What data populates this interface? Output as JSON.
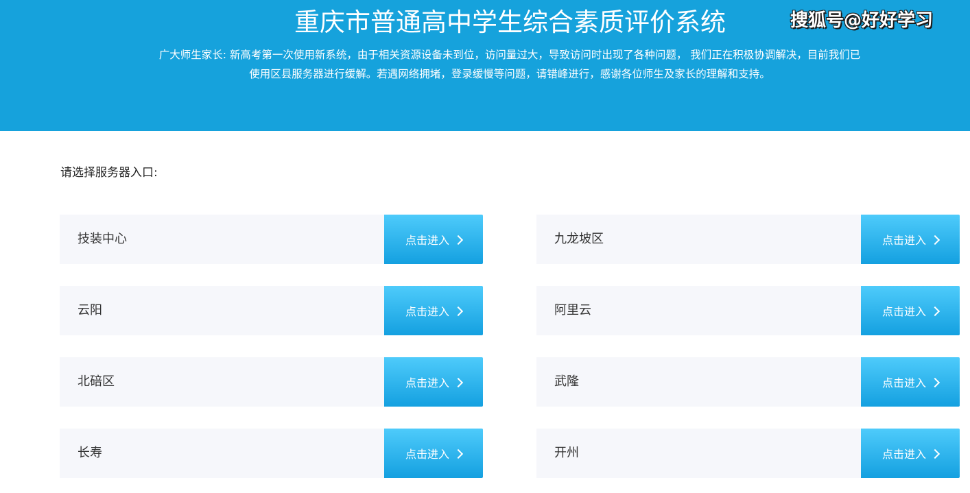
{
  "header": {
    "title": "重庆市普通高中学生综合素质评价系统",
    "watermark": "搜狐号@好好学习",
    "notice_line1": "广大师生家长: 新高考第一次使用新系统，由于相关资源设备未到位，访问量过大，导致访问时出现了各种问题， 我们正在积极协调解决，目前我们已",
    "notice_line2": "使用区县服务器进行缓解。若遇网络拥堵，登录缓慢等问题，请错峰进行，感谢各位师生及家长的理解和支持。"
  },
  "main": {
    "prompt": "请选择服务器入口:",
    "button_label": "点击进入",
    "entries": [
      {
        "name": "技装中心"
      },
      {
        "name": "九龙坡区"
      },
      {
        "name": "云阳"
      },
      {
        "name": "阿里云"
      },
      {
        "name": "北碚区"
      },
      {
        "name": "武隆"
      },
      {
        "name": "长寿"
      },
      {
        "name": "开州"
      }
    ]
  },
  "colors": {
    "header_bg": "#16a2dc",
    "button_gradient_top": "#4ecbfb",
    "button_gradient_bottom": "#14a0e0",
    "row_bg": "#f6f7fb"
  }
}
